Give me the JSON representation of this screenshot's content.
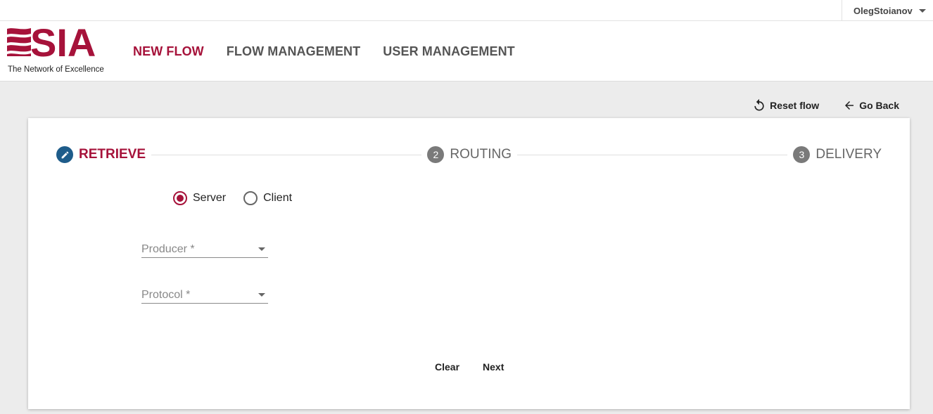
{
  "topbar": {
    "username": "OlegStoianov"
  },
  "header": {
    "logo": {
      "wordmark": "SIA",
      "tagline": "The Network of Excellence"
    },
    "nav": [
      {
        "label": "NEW FLOW",
        "active": true
      },
      {
        "label": "FLOW MANAGEMENT",
        "active": false
      },
      {
        "label": "USER MANAGEMENT",
        "active": false
      }
    ]
  },
  "actions": {
    "reset": "Reset flow",
    "back": "Go Back"
  },
  "stepper": {
    "steps": [
      {
        "number": "1",
        "label": "RETRIEVE",
        "state": "active",
        "icon": "pencil-icon"
      },
      {
        "number": "2",
        "label": "ROUTING",
        "state": "inactive"
      },
      {
        "number": "3",
        "label": "DELIVERY",
        "state": "inactive"
      }
    ]
  },
  "form": {
    "mode": {
      "options": [
        {
          "label": "Server",
          "checked": true
        },
        {
          "label": "Client",
          "checked": false
        }
      ]
    },
    "producer": {
      "placeholder": "Producer *"
    },
    "protocol": {
      "placeholder": "Protocol *"
    }
  },
  "buttons": {
    "clear": "Clear",
    "next": "Next"
  },
  "colors": {
    "brand": "#a6123a",
    "active_step": "#1e5c8a",
    "inactive_step": "#7a7a7a",
    "background": "#ececec"
  }
}
